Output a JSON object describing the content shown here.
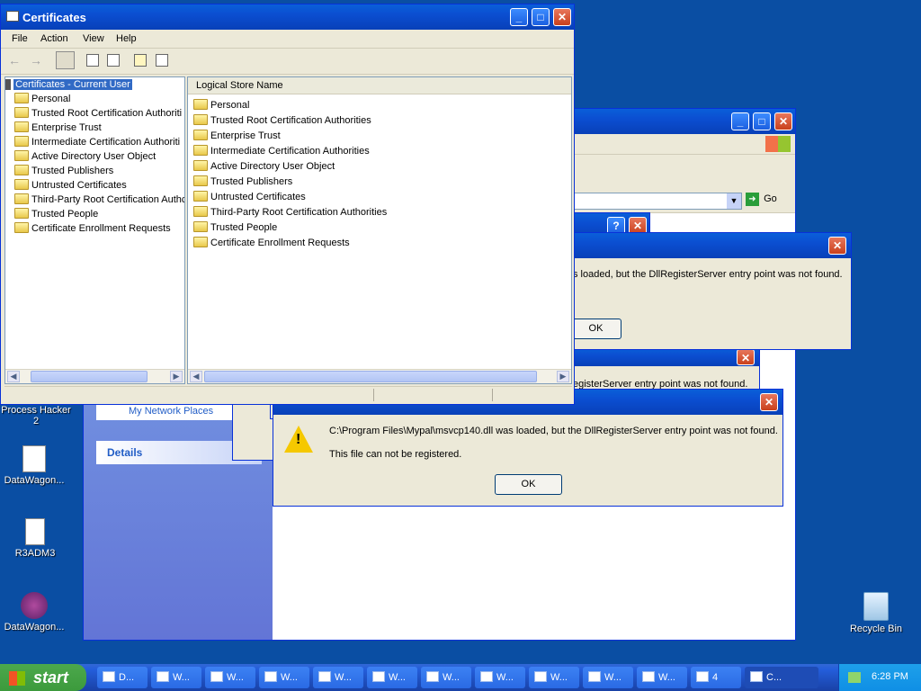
{
  "desktop": {
    "icons": [
      {
        "label": "Process Hacker\n2"
      },
      {
        "label": "DataWagon..."
      },
      {
        "label": "R3ADM3"
      },
      {
        "label": "DataWagon..."
      },
      {
        "label": "Recycle Bin"
      }
    ]
  },
  "cert_window": {
    "title": "Certificates",
    "menu": [
      "File",
      "Action",
      "View",
      "Help"
    ],
    "tree_root": "Certificates - Current User",
    "tree_items": [
      "Personal",
      "Trusted Root Certification Authoriti",
      "Enterprise Trust",
      "Intermediate Certification Authoriti",
      "Active Directory User Object",
      "Trusted Publishers",
      "Untrusted Certificates",
      "Third-Party Root Certification Authc",
      "Trusted People",
      "Certificate Enrollment Requests"
    ],
    "list_header": "Logical Store Name",
    "list_items": [
      "Personal",
      "Trusted Root Certification Authorities",
      "Enterprise Trust",
      "Intermediate Certification Authorities",
      "Active Directory User Object",
      "Trusted Publishers",
      "Untrusted Certificates",
      "Third-Party Root Certification Authorities",
      "Trusted People",
      "Certificate Enrollment Requests"
    ]
  },
  "explorer_window": {
    "go_label": "Go",
    "sidebar_link": "My Network Places",
    "details_label": "Details"
  },
  "dialog_back": {
    "message": "s loaded, but the DllRegisterServer entry point was not found.",
    "ok_label": "OK"
  },
  "dialog_mid": {
    "message": "egisterServer entry point was not found."
  },
  "dialog_front": {
    "message": "C:\\Program Files\\Mypal\\msvcp140.dll was loaded, but the DllRegisterServer entry point was not found.",
    "submessage": "This file can not be registered.",
    "ok_label": "OK"
  },
  "taskbar": {
    "start_label": "start",
    "buttons": [
      "D...",
      "W...",
      "W...",
      "W...",
      "W...",
      "W...",
      "W...",
      "W...",
      "W...",
      "W...",
      "W...",
      "4",
      "C..."
    ],
    "clock": "6:28 PM"
  },
  "colors": {
    "taskbar": "#245edb",
    "start": "#3c9a3c",
    "tray": "#0f8fe5"
  }
}
